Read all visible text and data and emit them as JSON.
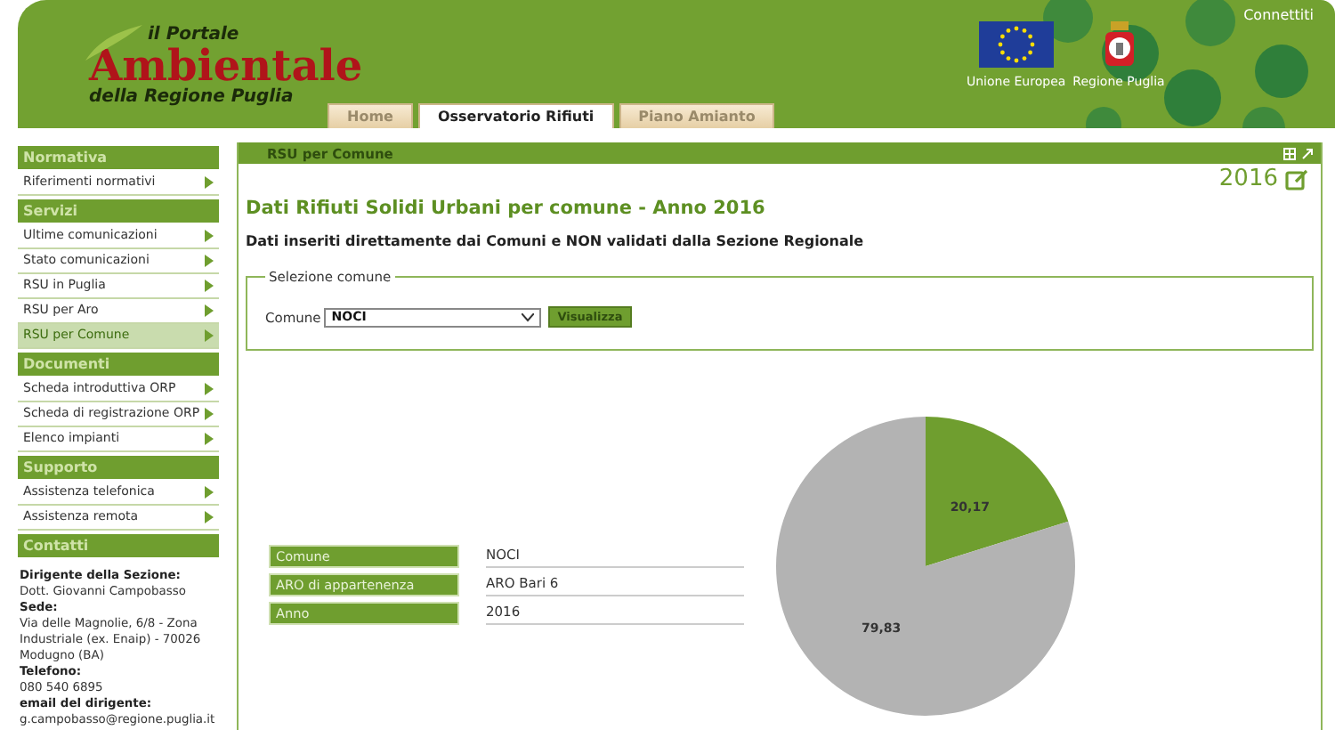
{
  "header": {
    "logo": {
      "line_1": "il Portale",
      "line_2": "Ambientale",
      "line_3": "della Regione Puglia"
    },
    "tabs": [
      {
        "label": "Home",
        "selected": false
      },
      {
        "label": "Osservatorio Rifiuti",
        "selected": true
      },
      {
        "label": "Piano Amianto",
        "selected": false
      }
    ],
    "emblems": [
      {
        "kind": "eu",
        "label": "Unione Europea"
      },
      {
        "kind": "region",
        "label": "Regione Puglia"
      }
    ],
    "login_link": "Connettiti"
  },
  "sidebar": {
    "sections": [
      {
        "title": "Normativa",
        "items": [
          {
            "label": "Riferimenti normativi",
            "selected": false
          }
        ]
      },
      {
        "title": "Servizi",
        "items": [
          {
            "label": "Ultime comunicazioni",
            "selected": false
          },
          {
            "label": "Stato comunicazioni",
            "selected": false
          },
          {
            "label": "RSU in Puglia",
            "selected": false
          },
          {
            "label": "RSU per Aro",
            "selected": false
          },
          {
            "label": "RSU per Comune",
            "selected": true
          }
        ]
      },
      {
        "title": "Documenti",
        "items": [
          {
            "label": "Scheda introduttiva ORP",
            "selected": false
          },
          {
            "label": "Scheda di registrazione ORP",
            "selected": false
          },
          {
            "label": "Elenco impianti",
            "selected": false
          }
        ]
      },
      {
        "title": "Supporto",
        "items": [
          {
            "label": "Assistenza telefonica",
            "selected": false
          },
          {
            "label": "Assistenza remota",
            "selected": false
          }
        ]
      },
      {
        "title": "Contatti"
      }
    ],
    "contacts": [
      {
        "kind": "label",
        "text": "Dirigente della Sezione:"
      },
      {
        "kind": "text",
        "text": "Dott. Giovanni Campobasso"
      },
      {
        "kind": "label",
        "text": "Sede:"
      },
      {
        "kind": "text",
        "text": "Via delle Magnolie, 6/8 - Zona Industriale (ex. Enaip) - 70026 Modugno (BA)"
      },
      {
        "kind": "label",
        "text": "Telefono:"
      },
      {
        "kind": "text",
        "text": "080 540 6895"
      },
      {
        "kind": "label",
        "text": "email del dirigente:"
      },
      {
        "kind": "text",
        "text": "g.campobasso@regione.puglia.it"
      }
    ]
  },
  "panel": {
    "title": "RSU per Comune",
    "year": "2016",
    "heading": "Dati Rifiuti Solidi Urbani per comune - Anno 2016",
    "subtitle": "Dati inseriti direttamente dai Comuni e NON validati dalla Sezione Regionale",
    "form": {
      "legend": "Selezione comune",
      "label": "Comune",
      "value": "NOCI",
      "button": "Visualizza"
    },
    "details": [
      {
        "label": "Comune",
        "value": "NOCI"
      },
      {
        "label": "ARO di appartenenza",
        "value": "ARO Bari 6"
      },
      {
        "label": "Anno",
        "value": "2016"
      }
    ],
    "chart_data": {
      "type": "pie",
      "values": [
        20.17,
        79.83
      ],
      "colors": [
        "#6f9e2f",
        "#b3b3b3"
      ],
      "data_labels": true,
      "value_labels": [
        "20,17",
        "79,83"
      ]
    }
  }
}
